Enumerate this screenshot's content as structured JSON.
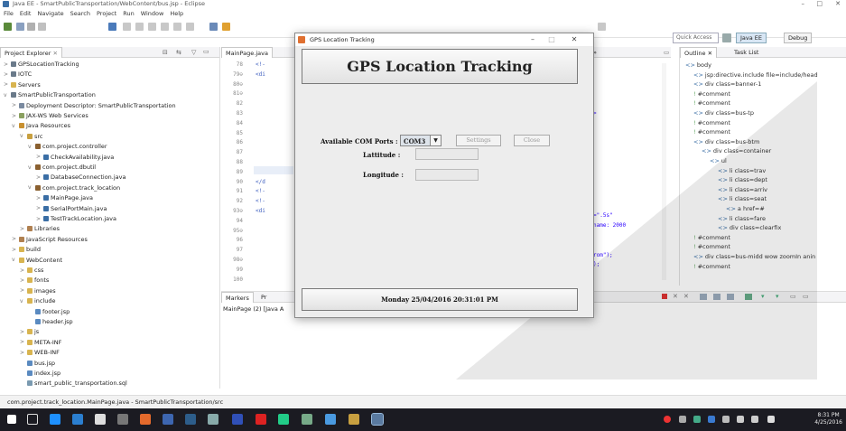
{
  "window": {
    "title": "Java EE - SmartPublicTransportation/WebContent/bus.jsp - Eclipse"
  },
  "menu": [
    "File",
    "Edit",
    "Navigate",
    "Search",
    "Project",
    "Run",
    "Window",
    "Help"
  ],
  "toolbar": {
    "quick_access": "Quick Access",
    "perspective_javaee": "Java EE",
    "perspective_debug": "Debug"
  },
  "explorer": {
    "tab": "Project Explorer",
    "tree": [
      {
        "label": "GPSLocationTracking",
        "depth": 0,
        "icon": "project-icon",
        "tw": ">"
      },
      {
        "label": "IOTC",
        "depth": 0,
        "icon": "project-icon",
        "tw": ">"
      },
      {
        "label": "Servers",
        "depth": 0,
        "icon": "folder-icon",
        "tw": ">"
      },
      {
        "label": "SmartPublicTransportation",
        "depth": 0,
        "icon": "project-icon",
        "tw": "v"
      },
      {
        "label": "Deployment Descriptor: SmartPublicTransportation",
        "depth": 1,
        "icon": "descriptor-icon",
        "tw": ">"
      },
      {
        "label": "JAX-WS Web Services",
        "depth": 1,
        "icon": "webservice-icon",
        "tw": ">"
      },
      {
        "label": "Java Resources",
        "depth": 1,
        "icon": "java-resources-icon",
        "tw": "v"
      },
      {
        "label": "src",
        "depth": 2,
        "icon": "source-folder-icon",
        "tw": "v"
      },
      {
        "label": "com.project.controller",
        "depth": 3,
        "icon": "package-icon",
        "tw": "v"
      },
      {
        "label": "CheckAvailability.java",
        "depth": 4,
        "icon": "java-file-icon",
        "tw": ">"
      },
      {
        "label": "com.project.dbutil",
        "depth": 3,
        "icon": "package-icon",
        "tw": "v"
      },
      {
        "label": "DatabaseConnection.java",
        "depth": 4,
        "icon": "java-file-icon",
        "tw": ">"
      },
      {
        "label": "com.project.track_location",
        "depth": 3,
        "icon": "package-icon",
        "tw": "v"
      },
      {
        "label": "MainPage.java",
        "depth": 4,
        "icon": "java-file-icon",
        "tw": ">"
      },
      {
        "label": "SerialPortMain.java",
        "depth": 4,
        "icon": "java-file-icon",
        "tw": ">"
      },
      {
        "label": "TestTrackLocation.java",
        "depth": 4,
        "icon": "java-file-icon",
        "tw": ">"
      },
      {
        "label": "Libraries",
        "depth": 2,
        "icon": "library-icon",
        "tw": ">"
      },
      {
        "label": "JavaScript Resources",
        "depth": 1,
        "icon": "library-icon",
        "tw": ">"
      },
      {
        "label": "build",
        "depth": 1,
        "icon": "folder-icon",
        "tw": ">"
      },
      {
        "label": "WebContent",
        "depth": 1,
        "icon": "folder-icon",
        "tw": "v"
      },
      {
        "label": "css",
        "depth": 2,
        "icon": "folder-icon",
        "tw": ">"
      },
      {
        "label": "fonts",
        "depth": 2,
        "icon": "folder-icon",
        "tw": ">"
      },
      {
        "label": "images",
        "depth": 2,
        "icon": "folder-icon",
        "tw": ">"
      },
      {
        "label": "include",
        "depth": 2,
        "icon": "folder-icon",
        "tw": "v"
      },
      {
        "label": "footer.jsp",
        "depth": 3,
        "icon": "jsp-file-icon",
        "tw": ""
      },
      {
        "label": "header.jsp",
        "depth": 3,
        "icon": "jsp-file-icon",
        "tw": ""
      },
      {
        "label": "js",
        "depth": 2,
        "icon": "folder-icon",
        "tw": ">"
      },
      {
        "label": "META-INF",
        "depth": 2,
        "icon": "folder-icon",
        "tw": ">"
      },
      {
        "label": "WEB-INF",
        "depth": 2,
        "icon": "folder-icon",
        "tw": ">"
      },
      {
        "label": "bus.jsp",
        "depth": 2,
        "icon": "jsp-file-icon",
        "tw": ""
      },
      {
        "label": "index.jsp",
        "depth": 2,
        "icon": "jsp-file-icon",
        "tw": ""
      },
      {
        "label": "smart_public_transportation.sql",
        "depth": 2,
        "icon": "sql-file-icon",
        "tw": ""
      }
    ]
  },
  "editor": {
    "tab": "MainPage.java",
    "lines": [
      {
        "num": "78",
        "code": "<!-"
      },
      {
        "num": "79⊖",
        "code": "<di"
      },
      {
        "num": "80⊖",
        "code": ""
      },
      {
        "num": "81⊖",
        "code": ""
      },
      {
        "num": "82",
        "code": ""
      },
      {
        "num": "83",
        "code": ""
      },
      {
        "num": "84",
        "code": ""
      },
      {
        "num": "85",
        "code": ""
      },
      {
        "num": "86",
        "code": ""
      },
      {
        "num": "87",
        "code": ""
      },
      {
        "num": "88",
        "code": ""
      },
      {
        "num": "89",
        "code": ""
      },
      {
        "num": "90",
        "code": "</d"
      },
      {
        "num": "91",
        "code": "<!-"
      },
      {
        "num": "92",
        "code": "<!-"
      },
      {
        "num": "93⊖",
        "code": "<di"
      },
      {
        "num": "94",
        "code": ""
      },
      {
        "num": "95⊖",
        "code": ""
      },
      {
        "num": "96",
        "code": ""
      },
      {
        "num": "97",
        "code": ""
      },
      {
        "num": "98⊖",
        "code": ""
      },
      {
        "num": "99",
        "code": ""
      },
      {
        "num": "100",
        "code": ""
      }
    ],
    "right_fragments": [
      ">",
      "=\".5s\"",
      "name: 2000",
      "rom\");",
      ");"
    ]
  },
  "outline": {
    "tab": "Outline",
    "tab2": "Task List",
    "nodes": [
      {
        "label": "body",
        "depth": 0
      },
      {
        "label": "jsp:directive.include file=include/head",
        "depth": 1
      },
      {
        "label": "div class=banner-1",
        "depth": 1
      },
      {
        "label": "#comment",
        "depth": 1
      },
      {
        "label": "#comment",
        "depth": 1
      },
      {
        "label": "div class=bus-tp",
        "depth": 1
      },
      {
        "label": "#comment",
        "depth": 1
      },
      {
        "label": "#comment",
        "depth": 1
      },
      {
        "label": "div class=bus-btm",
        "depth": 1
      },
      {
        "label": "div class=container",
        "depth": 2
      },
      {
        "label": "ul",
        "depth": 3
      },
      {
        "label": "li class=trav",
        "depth": 4
      },
      {
        "label": "li class=dept",
        "depth": 4
      },
      {
        "label": "li class=arriv",
        "depth": 4
      },
      {
        "label": "li class=seat",
        "depth": 4
      },
      {
        "label": "a href=#",
        "depth": 5
      },
      {
        "label": "li class=fare",
        "depth": 4
      },
      {
        "label": "div class=clearfix",
        "depth": 4
      },
      {
        "label": "#comment",
        "depth": 1
      },
      {
        "label": "#comment",
        "depth": 1
      },
      {
        "label": "div class=bus-midd wow zoomIn anin",
        "depth": 1
      },
      {
        "label": "#comment",
        "depth": 1
      }
    ]
  },
  "markers": {
    "tab": "Markers",
    "tab2": "Pr",
    "console_text": "MainPage (2) [Java A"
  },
  "status": {
    "text": "com.project.track_location.MainPage.java - SmartPublicTransportation/src"
  },
  "taskbar": {
    "time": "8:31 PM",
    "date": "4/25/2016"
  },
  "dialog": {
    "title": "GPS Location Tracking",
    "heading": "GPS Location Tracking",
    "com_label": "Available COM Ports :",
    "com_value": "COM3",
    "settings": "Settings",
    "close": "Close",
    "lat_label": "Lattitude :",
    "lon_label": "Longitude :",
    "datetime": "Monday  25/04/2016 20:31:01 PM"
  },
  "colors": {
    "accent": "#1e5fa8",
    "taskbar": "#1b1b22",
    "dialog_bg": "#ededed"
  }
}
